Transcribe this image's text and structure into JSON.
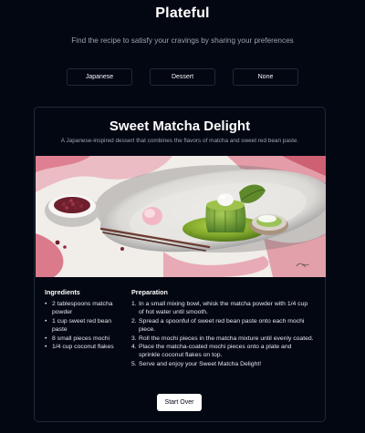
{
  "app": {
    "title": "Plateful",
    "subtitle": "Find the recipe to satisfy your cravings by sharing your preferences"
  },
  "preferences": [
    "Japanese",
    "Dessert",
    "None"
  ],
  "recipe": {
    "title": "Sweet Matcha Delight",
    "description": "A Japanese-inspired dessert that combines the flavors of matcha and sweet red bean paste.",
    "image_alt": "Watercolor illustration of a matcha mochi dessert on a plate",
    "ingredients_heading": "Ingredients",
    "ingredients": [
      "2 tablespoons matcha powder",
      "1 cup sweet red bean paste",
      "8 small pieces mochi",
      "1/4 cup coconut flakes"
    ],
    "preparation_heading": "Preparation",
    "steps": [
      "In a small mixing bowl, whisk the matcha powder with 1/4 cup of hot water until smooth.",
      "Spread a spoonful of sweet red bean paste onto each mochi piece.",
      "Roll the mochi pieces in the matcha mixture until evenly coated.",
      "Place the matcha-coated mochi pieces onto a plate and sprinkle coconut flakes on top.",
      "Serve and enjoy your Sweet Matcha Delight!"
    ]
  },
  "actions": {
    "start_over": "Start Over"
  },
  "colors": {
    "background": "#030712",
    "border": "#1f2937",
    "muted_text": "#9ca3af",
    "button_bg": "#ffffff"
  }
}
